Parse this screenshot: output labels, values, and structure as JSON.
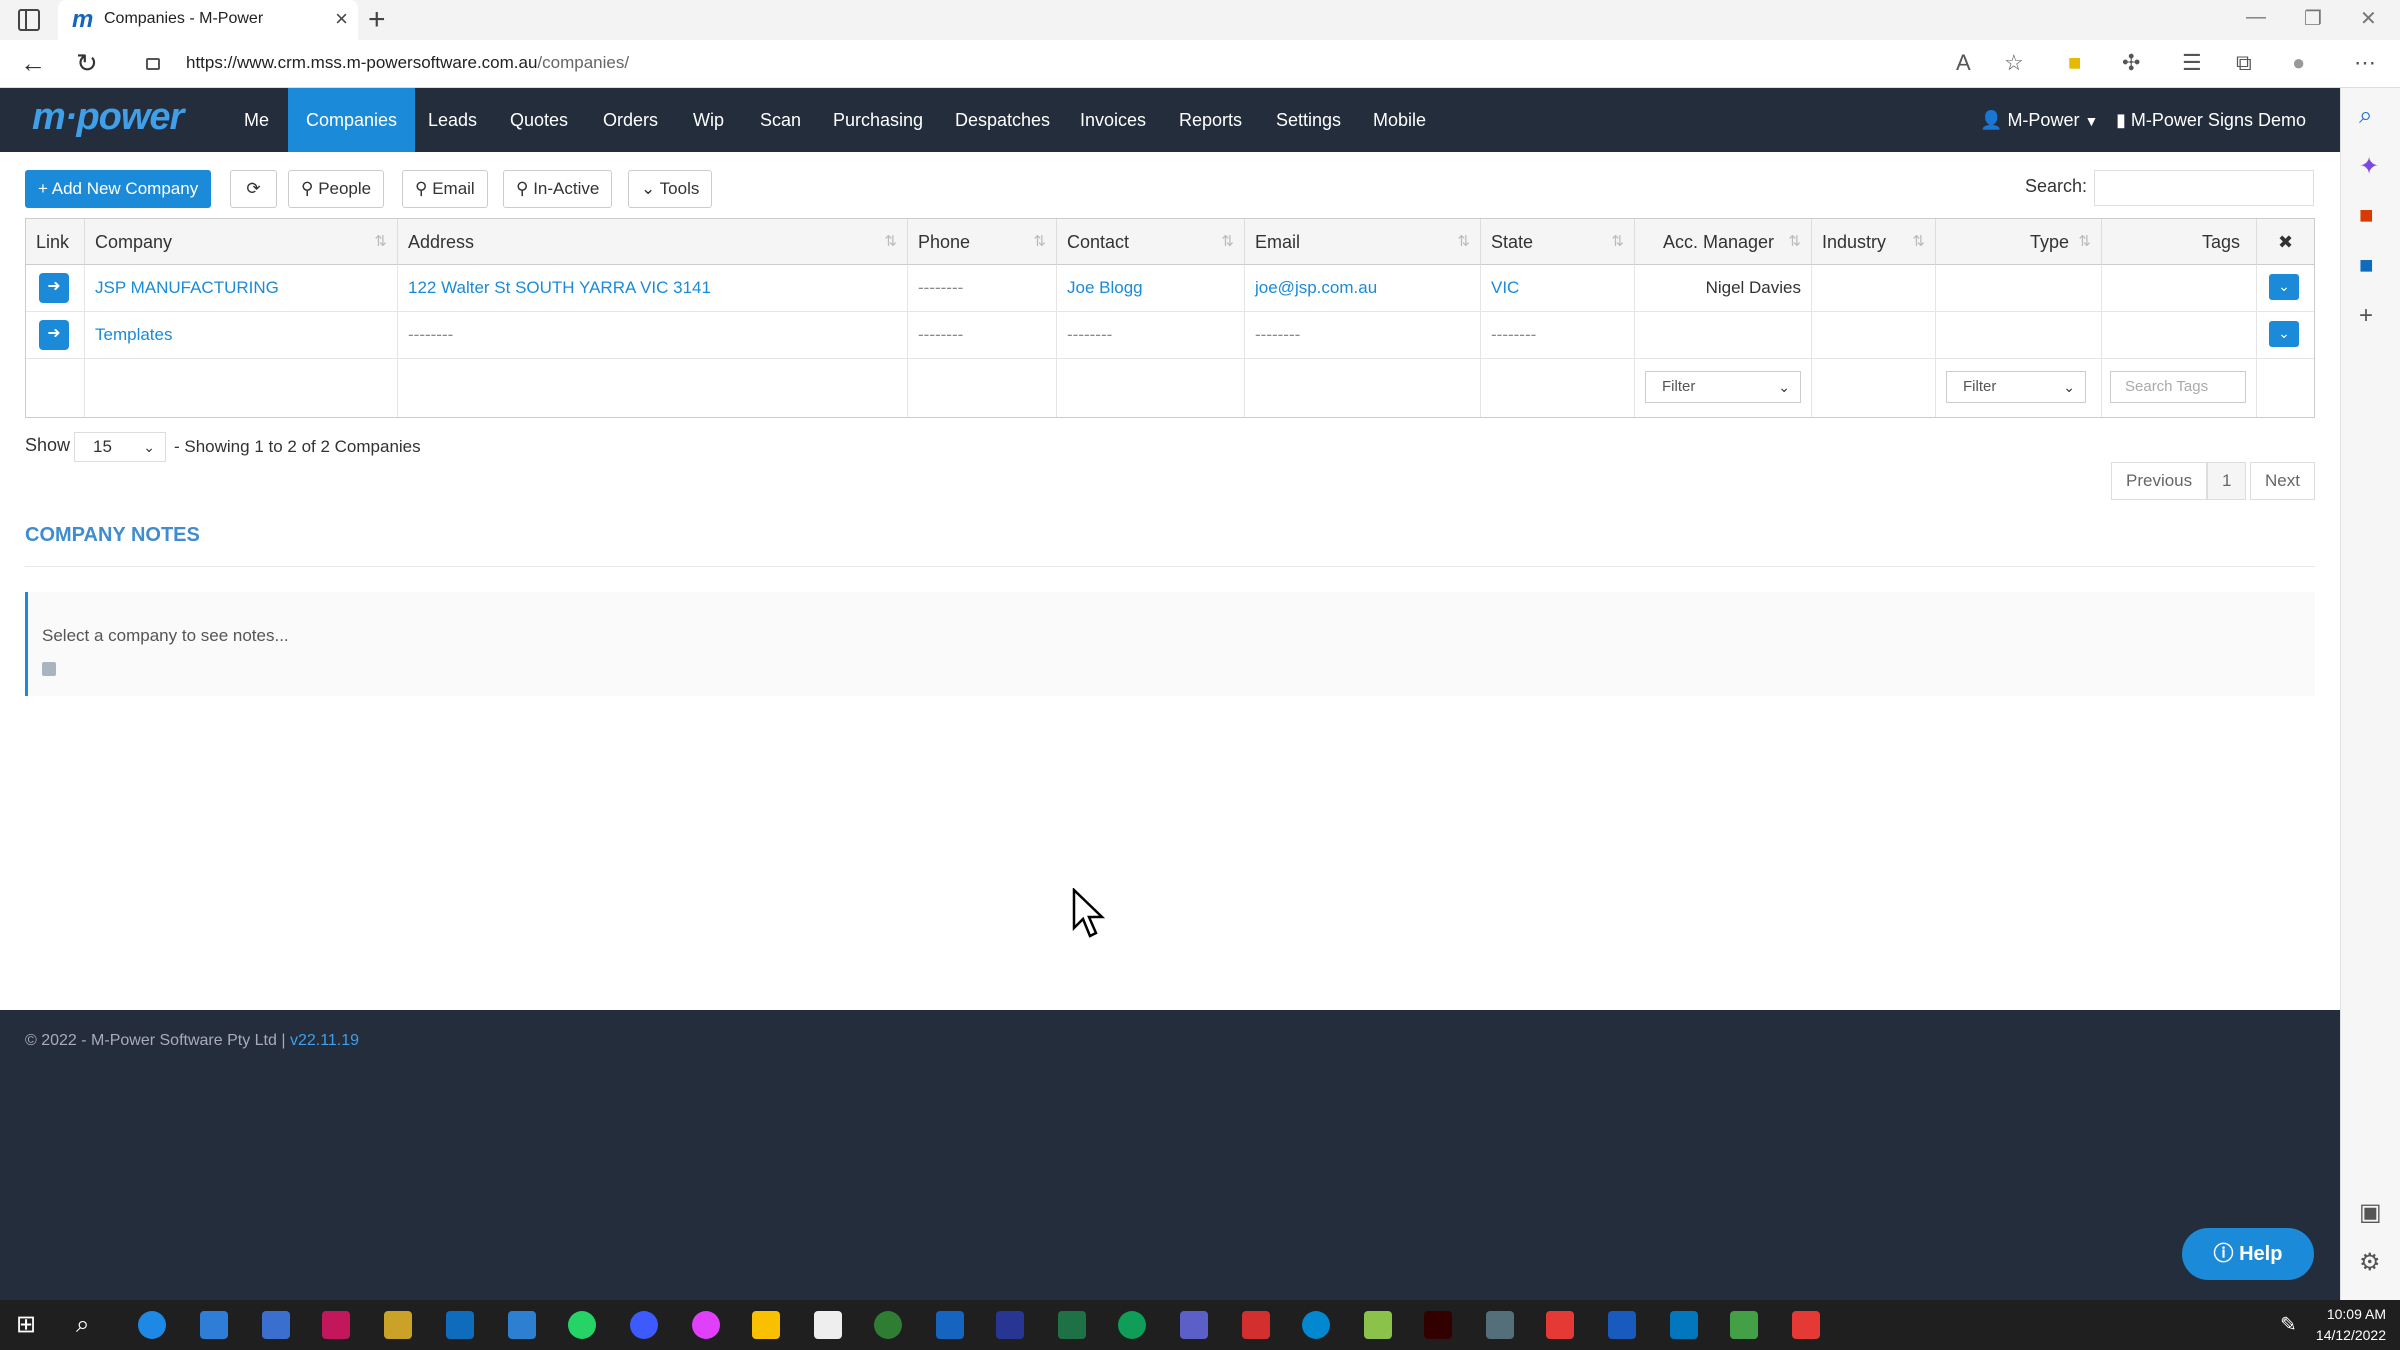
{
  "browser": {
    "tab_title": "Companies - M-Power",
    "tab_favicon": "m",
    "url_host": "https://www.crm.mss.m-powersoftware.com.au",
    "url_path": "/companies/"
  },
  "app": {
    "logo": "m·power",
    "nav": [
      "Me",
      "Companies",
      "Leads",
      "Quotes",
      "Orders",
      "Wip",
      "Scan",
      "Purchasing",
      "Despatches",
      "Invoices",
      "Reports",
      "Settings",
      "Mobile"
    ],
    "active_nav": "Companies",
    "user_menu": "M-Power",
    "company_menu": "M-Power Signs Demo"
  },
  "toolbar": {
    "add": "Add New Company",
    "people": "People",
    "email": "Email",
    "inactive": "In-Active",
    "tools": "Tools",
    "search_label": "Search:"
  },
  "table": {
    "headers": [
      "Link",
      "Company",
      "Address",
      "Phone",
      "Contact",
      "Email",
      "State",
      "Acc. Manager",
      "Industry",
      "Type",
      "Tags"
    ],
    "rows": [
      {
        "company": "JSP MANUFACTURING",
        "address": "122 Walter St SOUTH YARRA VIC 3141",
        "phone": "--------",
        "contact": "Joe Blogg",
        "email": "joe@jsp.com.au",
        "state": "VIC",
        "acc_manager": "Nigel Davies"
      },
      {
        "company": "Templates",
        "address": "--------",
        "phone": "--------",
        "contact": "--------",
        "email": "--------",
        "state": "--------",
        "acc_manager": ""
      }
    ],
    "filter_acc": "Filter",
    "filter_type": "Filter",
    "search_tags_placeholder": "Search Tags"
  },
  "paging": {
    "show_label": "Show",
    "page_size": "15",
    "showing": "- Showing 1 to 2 of 2 Companies",
    "previous": "Previous",
    "page": "1",
    "next": "Next"
  },
  "notes": {
    "title": "COMPANY NOTES",
    "placeholder": "Select a company to see notes..."
  },
  "footer": {
    "copyright": "© 2022 - M-Power Software Pty Ltd |",
    "version": "v22.11.19"
  },
  "help": "Help",
  "taskbar": {
    "time": "10:09 AM",
    "date": "14/12/2022"
  }
}
